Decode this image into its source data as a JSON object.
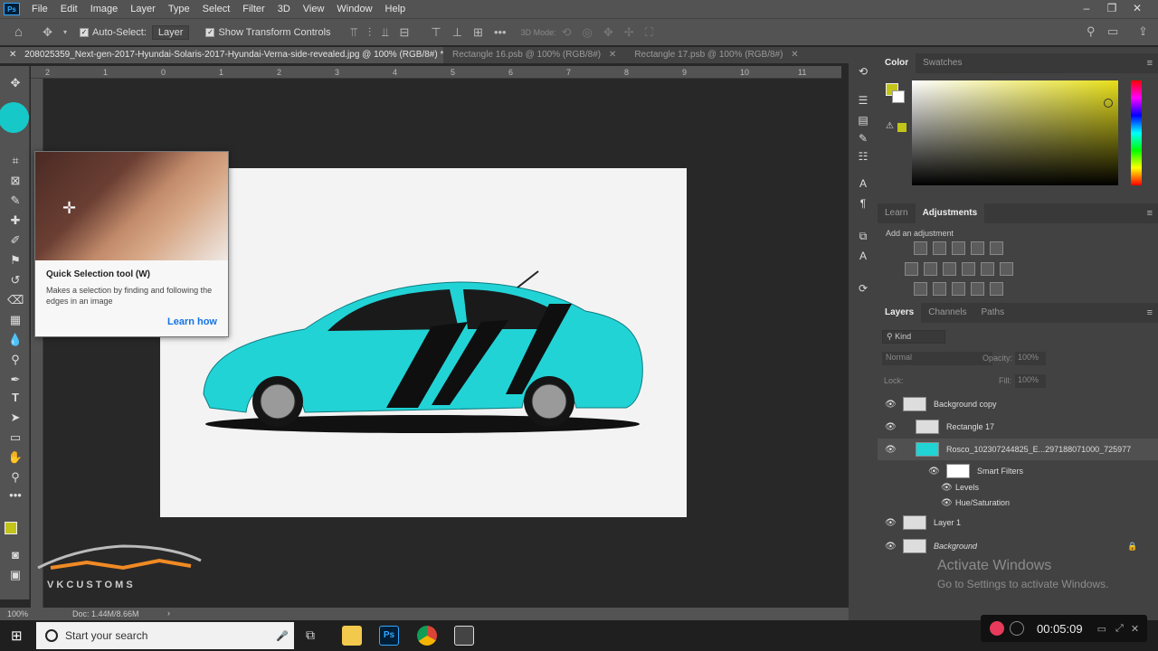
{
  "menubar": {
    "logo": "Ps",
    "items": [
      "File",
      "Edit",
      "Image",
      "Layer",
      "Type",
      "Select",
      "Filter",
      "3D",
      "View",
      "Window",
      "Help"
    ]
  },
  "options_bar": {
    "auto_select_label": "Auto-Select:",
    "auto_select_value": "Layer",
    "show_transform_label": "Show Transform Controls",
    "mode_3d_label": "3D Mode:"
  },
  "tabs": [
    {
      "label": "208025359_Next-gen-2017-Hyundai-Solaris-2017-Hyundai-Verna-side-revealed.jpg @ 100% (RGB/8#) *",
      "active": true
    },
    {
      "label": "Rectangle 16.psb @ 100% (RGB/8#)",
      "active": false
    },
    {
      "label": "Rectangle 17.psb @ 100% (RGB/8#)",
      "active": false
    }
  ],
  "ruler_labels": [
    "2",
    "1",
    "0",
    "1",
    "2",
    "3",
    "4",
    "5",
    "6",
    "7",
    "8",
    "9",
    "10",
    "11"
  ],
  "tooltip": {
    "title": "Quick Selection tool (W)",
    "body": "Makes a selection by finding and following the edges in an image",
    "link": "Learn how"
  },
  "status": {
    "zoom": "100%",
    "doc": "Doc: 1.44M/8.66M"
  },
  "color_panel": {
    "tabs": [
      "Color",
      "Swatches"
    ],
    "fg_color": "#c3c41a"
  },
  "learn_panel": {
    "tabs": [
      "Learn",
      "Adjustments"
    ],
    "add_adjustment": "Add an adjustment"
  },
  "layers_panel": {
    "tabs": [
      "Layers",
      "Channels",
      "Paths"
    ],
    "filter_kind": "Kind",
    "blend_mode": "Normal",
    "opacity_label": "Opacity:",
    "opacity_value": "100%",
    "lock_label": "Lock:",
    "fill_label": "Fill:",
    "fill_value": "100%",
    "layers": [
      {
        "name": "Background copy",
        "selected": false
      },
      {
        "name": "Rectangle 17",
        "selected": false
      },
      {
        "name": "Rosco_102307244825_E...297188071000_725977",
        "selected": true
      },
      {
        "name": "Smart Filters",
        "selected": false
      },
      {
        "name": "Levels",
        "selected": false
      },
      {
        "name": "Hue/Saturation",
        "selected": false
      },
      {
        "name": "Layer 1",
        "selected": false
      },
      {
        "name": "Background",
        "selected": false
      }
    ]
  },
  "watermark": {
    "line1": "Activate Windows",
    "line2": "Go to Settings to activate Windows."
  },
  "taskbar": {
    "search_placeholder": "Start your search"
  },
  "recorder": {
    "time": "00:05:09"
  },
  "logo_text": "V K   C U S T O M S"
}
